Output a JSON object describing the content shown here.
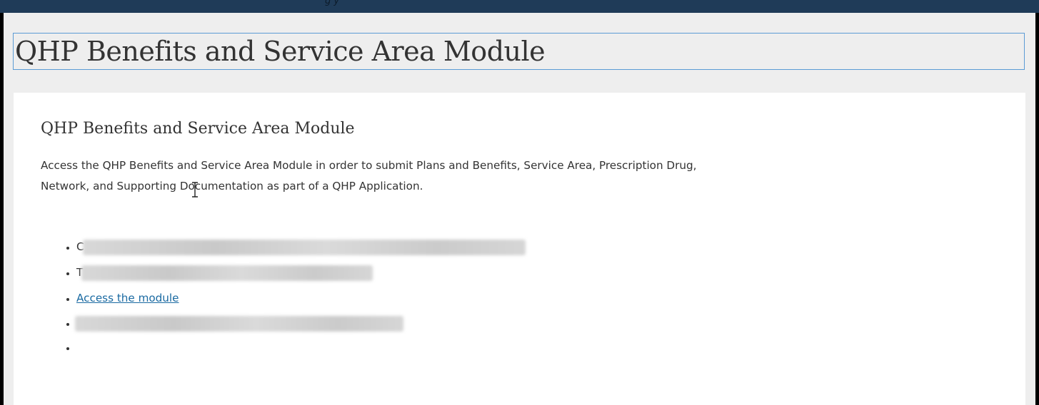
{
  "header": {
    "top_text": "g                                               y"
  },
  "page": {
    "title": "QHP Benefits and Service Area Module"
  },
  "card": {
    "heading": "QHP Benefits and Service Area Module",
    "description": "Access the QHP Benefits and Service Area Module in order to submit Plans and Benefits, Service Area, Prescription Drug, Network, and Supporting Documentation as part of a QHP Application.",
    "bullets": [
      {
        "visible_prefix": "C",
        "redacted": true
      },
      {
        "visible_prefix": "T",
        "redacted": true
      },
      {
        "link_text": "Access the module",
        "redacted": false
      },
      {
        "visible_prefix": "",
        "redacted": true
      },
      {
        "visible_prefix": "",
        "redacted": false
      }
    ]
  },
  "colors": {
    "top_bar": "#1f3b58",
    "link": "#1a6aa2",
    "title_border": "#5b9bd5"
  }
}
